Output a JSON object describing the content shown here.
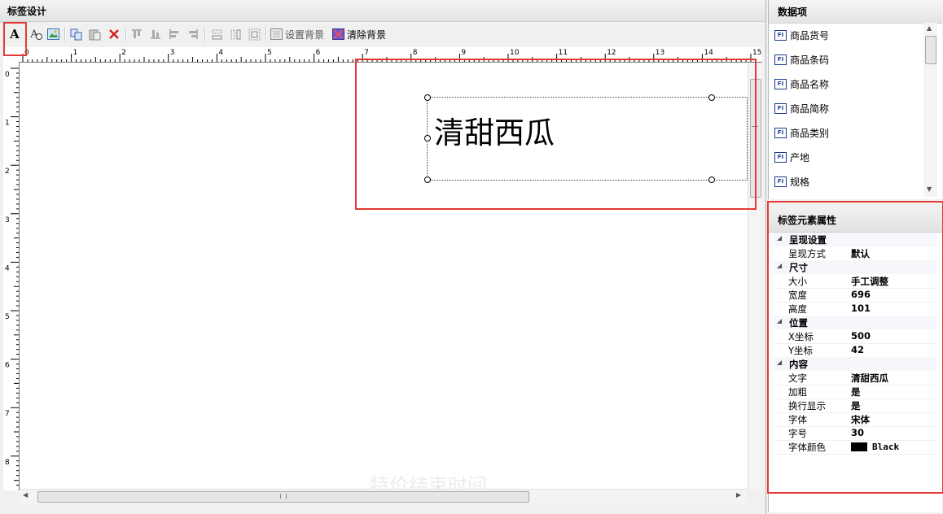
{
  "designer": {
    "title": "标签设计",
    "toolbar": {
      "set_bg_label": "设置背景",
      "clear_bg_label": "清除背景"
    },
    "ruler_top": [
      "0",
      "1",
      "2",
      "3",
      "4",
      "5",
      "6",
      "7",
      "8",
      "9",
      "10",
      "11",
      "12",
      "13",
      "14",
      "15"
    ],
    "ruler_left": [
      "0",
      "1",
      "2",
      "3",
      "4",
      "5",
      "6",
      "7",
      "8"
    ],
    "canvas": {
      "label_text": "清甜西瓜"
    },
    "watermark": "特价结束时间"
  },
  "data_items": {
    "title": "数据项",
    "icon_text": "FI",
    "items": [
      "商品货号",
      "商品条码",
      "商品名称",
      "商品简称",
      "商品类别",
      "产地",
      "规格"
    ]
  },
  "properties": {
    "title": "标签元素属性",
    "cat_render": "呈现设置",
    "render_mode_name": "呈现方式",
    "render_mode_val": "默认",
    "cat_size": "尺寸",
    "size_name": "大小",
    "size_val": "手工调整",
    "width_name": "宽度",
    "width_val": "696",
    "height_name": "高度",
    "height_val": "101",
    "cat_pos": "位置",
    "x_name": "X坐标",
    "x_val": "500",
    "y_name": "Y坐标",
    "y_val": "42",
    "cat_content": "内容",
    "text_name": "文字",
    "text_val": "清甜西瓜",
    "bold_name": "加粗",
    "bold_val": "是",
    "wrap_name": "换行显示",
    "wrap_val": "是",
    "font_name": "字体",
    "font_val": "宋体",
    "fsize_name": "字号",
    "fsize_val": "30",
    "fcolor_name": "字体颜色",
    "fcolor_val": "Black"
  },
  "colors": {
    "highlight": "#e53935",
    "icon_blue": "#1b3b8a"
  }
}
